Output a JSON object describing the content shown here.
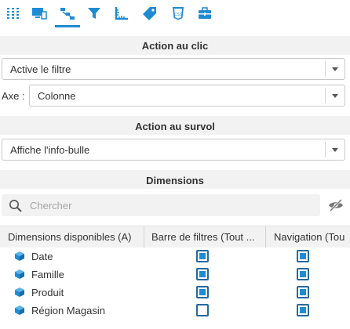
{
  "toolbar": {
    "active_tab_index": 2,
    "icons": [
      "columns-icon",
      "monitor-icon",
      "interaction-icon",
      "filter-icon",
      "ruler-icon",
      "tag-icon",
      "css-icon",
      "toolbox-icon"
    ],
    "accent_color": "#1e8bd4"
  },
  "click_section": {
    "title": "Action au clic",
    "action_value": "Active le filtre",
    "axis_label": "Axe :",
    "axis_value": "Colonne"
  },
  "hover_section": {
    "title": "Action au survol",
    "action_value": "Affiche l'info-bulle"
  },
  "dimensions_section": {
    "title": "Dimensions",
    "search_placeholder": "Chercher",
    "columns": [
      "Dimensions disponibles (A)",
      "Barre de filtres (Tout ...",
      "Navigation (Tou"
    ],
    "rows": [
      {
        "label": "Date",
        "filter_bar": true,
        "navigation": true
      },
      {
        "label": "Famille",
        "filter_bar": true,
        "navigation": true
      },
      {
        "label": "Produit",
        "filter_bar": true,
        "navigation": true
      },
      {
        "label": "Région Magasin",
        "filter_bar": false,
        "navigation": true
      }
    ]
  }
}
